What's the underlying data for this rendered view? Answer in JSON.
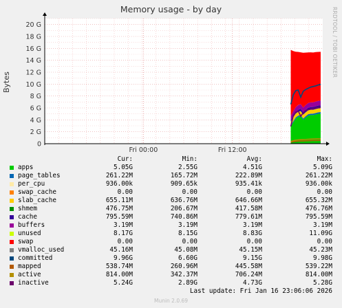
{
  "chart_data": {
    "type": "area",
    "title": "Memory usage - by day",
    "ylabel": "Bytes",
    "ylim": [
      0,
      21
    ],
    "yticks": [
      0,
      2,
      4,
      6,
      8,
      10,
      12,
      14,
      16,
      18,
      20
    ],
    "ytick_labels": [
      "0",
      "2 G",
      "4 G",
      "6 G",
      "8 G",
      "10 G",
      "12 G",
      "14 G",
      "16 G",
      "18 G",
      "20 G"
    ],
    "x_tick_labels": [
      {
        "label": "Fri 00:00",
        "frac": 0.355
      },
      {
        "label": "Fri 12:00",
        "frac": 0.675
      }
    ],
    "data_start_frac": 0.885,
    "grid": true,
    "series": [
      {
        "name": "apps",
        "color": "#00cc00",
        "values": [
          2.9,
          3.6,
          4.2,
          4.5,
          4.6,
          4.0,
          4.4,
          4.7,
          4.8,
          4.8,
          4.9,
          5.0,
          5.05
        ]
      },
      {
        "name": "page_tables",
        "color": "#0066b3",
        "values": [
          0.17,
          0.19,
          0.21,
          0.22,
          0.22,
          0.23,
          0.23,
          0.24,
          0.24,
          0.25,
          0.25,
          0.26,
          0.26
        ]
      },
      {
        "name": "per_cpu",
        "color": "#ffeaa8",
        "values": [
          0.001,
          0.001,
          0.001,
          0.001,
          0.001,
          0.001,
          0.001,
          0.001,
          0.001,
          0.001,
          0.001,
          0.001,
          0.001
        ]
      },
      {
        "name": "swap_cache",
        "color": "#ff8000",
        "values": [
          0,
          0,
          0,
          0,
          0,
          0,
          0,
          0,
          0,
          0,
          0,
          0,
          0
        ]
      },
      {
        "name": "slab_cache",
        "color": "#ffcc00",
        "values": [
          0.64,
          0.64,
          0.645,
          0.645,
          0.65,
          0.65,
          0.65,
          0.65,
          0.65,
          0.65,
          0.655,
          0.655,
          0.655
        ]
      },
      {
        "name": "shmem",
        "color": "#330099",
        "values": [
          0.21,
          0.25,
          0.3,
          0.35,
          0.38,
          0.4,
          0.42,
          0.44,
          0.45,
          0.46,
          0.47,
          0.475,
          0.477
        ]
      },
      {
        "name": "cache",
        "color": "#990099",
        "values": [
          0.74,
          0.76,
          0.77,
          0.78,
          0.78,
          0.78,
          0.785,
          0.79,
          0.79,
          0.79,
          0.795,
          0.795,
          0.796
        ]
      },
      {
        "name": "buffers",
        "color": "#ccff00",
        "values": [
          0.003,
          0.003,
          0.003,
          0.003,
          0.003,
          0.003,
          0.003,
          0.003,
          0.003,
          0.003,
          0.003,
          0.003,
          0.003
        ]
      },
      {
        "name": "unused",
        "color": "#ff0000",
        "values": [
          11.09,
          10.1,
          9.3,
          8.9,
          8.7,
          9.2,
          8.8,
          8.5,
          8.4,
          8.35,
          8.3,
          8.22,
          8.17
        ]
      },
      {
        "name": "swap",
        "color": "#808080",
        "values": [
          0,
          0,
          0,
          0,
          0,
          0,
          0,
          0,
          0,
          0,
          0,
          0,
          0
        ]
      }
    ],
    "lines": [
      {
        "name": "vmalloc_used",
        "color": "#008f00",
        "values": [
          0.045,
          0.045,
          0.045,
          0.045,
          0.045,
          0.045,
          0.045,
          0.045,
          0.045,
          0.045,
          0.045,
          0.045,
          0.045
        ]
      },
      {
        "name": "committed",
        "color": "#00487d",
        "values": [
          6.6,
          8.2,
          8.9,
          9.0,
          7.8,
          8.8,
          9.1,
          9.3,
          9.5,
          9.6,
          9.7,
          9.85,
          9.96
        ]
      },
      {
        "name": "mapped",
        "color": "#b35a00",
        "values": [
          0.26,
          0.35,
          0.4,
          0.43,
          0.45,
          0.46,
          0.48,
          0.5,
          0.51,
          0.52,
          0.53,
          0.535,
          0.539
        ]
      },
      {
        "name": "active",
        "color": "#b38f00",
        "values": [
          0.34,
          0.5,
          0.6,
          0.65,
          0.68,
          0.7,
          0.72,
          0.75,
          0.77,
          0.79,
          0.8,
          0.81,
          0.814
        ]
      },
      {
        "name": "inactive",
        "color": "#6b006b",
        "values": [
          2.89,
          4.7,
          5.3,
          5.5,
          4.6,
          5.2,
          5.6,
          5.7,
          5.8,
          5.9,
          6.0,
          6.1,
          6.15
        ]
      }
    ]
  },
  "side_text": "RRDTOOL / TOBI OETIKER",
  "legend": {
    "headers": {
      "cur": "Cur:",
      "min": "Min:",
      "avg": "Avg:",
      "max": "Max:"
    },
    "rows": [
      {
        "name": "apps",
        "color": "#00cc00",
        "cur": "5.05G",
        "min": "2.55G",
        "avg": "4.51G",
        "max": "5.09G"
      },
      {
        "name": "page_tables",
        "color": "#0066b3",
        "cur": "261.22M",
        "min": "165.72M",
        "avg": "222.89M",
        "max": "261.22M"
      },
      {
        "name": "per_cpu",
        "color": "#ffeaa8",
        "cur": "936.00k",
        "min": "909.65k",
        "avg": "935.41k",
        "max": "936.00k"
      },
      {
        "name": "swap_cache",
        "color": "#ff8000",
        "cur": "0.00",
        "min": "0.00",
        "avg": "0.00",
        "max": "0.00"
      },
      {
        "name": "slab_cache",
        "color": "#ffcc00",
        "cur": "655.11M",
        "min": "636.76M",
        "avg": "646.66M",
        "max": "655.32M"
      },
      {
        "name": "shmem",
        "color": "#008f00",
        "cur": "476.75M",
        "min": "206.67M",
        "avg": "417.58M",
        "max": "476.76M"
      },
      {
        "name": "cache",
        "color": "#330099",
        "cur": "795.59M",
        "min": "740.86M",
        "avg": "779.61M",
        "max": "795.59M"
      },
      {
        "name": "buffers",
        "color": "#990099",
        "cur": "3.19M",
        "min": "3.19M",
        "avg": "3.19M",
        "max": "3.19M"
      },
      {
        "name": "unused",
        "color": "#ccff00",
        "cur": "8.17G",
        "min": "8.15G",
        "avg": "8.83G",
        "max": "11.09G"
      },
      {
        "name": "swap",
        "color": "#ff0000",
        "cur": "0.00",
        "min": "0.00",
        "avg": "0.00",
        "max": "0.00"
      },
      {
        "name": "vmalloc_used",
        "color": "#808080",
        "cur": "45.16M",
        "min": "45.08M",
        "avg": "45.15M",
        "max": "45.23M"
      },
      {
        "name": "committed",
        "color": "#00487d",
        "cur": "9.96G",
        "min": "6.60G",
        "avg": "9.15G",
        "max": "9.98G"
      },
      {
        "name": "mapped",
        "color": "#b35a00",
        "cur": "538.74M",
        "min": "260.96M",
        "avg": "445.58M",
        "max": "539.22M"
      },
      {
        "name": "active",
        "color": "#b38f00",
        "cur": "814.00M",
        "min": "342.37M",
        "avg": "706.24M",
        "max": "814.00M"
      },
      {
        "name": "inactive",
        "color": "#6b006b",
        "cur": "5.24G",
        "min": "2.89G",
        "avg": "4.73G",
        "max": "5.28G"
      }
    ]
  },
  "last_update": "Last update: Fri Jan 16 23:06:06 2026",
  "footer": "Munin 2.0.69"
}
